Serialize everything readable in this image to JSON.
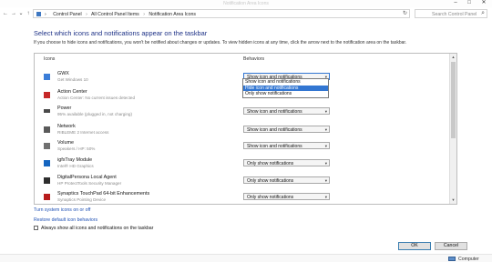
{
  "window": {
    "title": "Notification Area Icons",
    "minimize_glyph": "–",
    "maximize_glyph": "□",
    "close_glyph": "✕"
  },
  "nav": {
    "back_glyph": "←",
    "forward_glyph": "→",
    "recent_glyph": "⌄",
    "up_glyph": "↑"
  },
  "breadcrumb": {
    "items": [
      "Control Panel",
      "All Control Panel Items",
      "Notification Area Icons"
    ],
    "separator": "›",
    "dropdown_glyph": "⌄",
    "refresh_glyph": "↻"
  },
  "search": {
    "placeholder": "Search Control Panel",
    "icon_glyph": "⌕"
  },
  "page": {
    "heading": "Select which icons and notifications appear on the taskbar",
    "description": "If you choose to hide icons and notifications, you won't be notified about changes or updates. To view hidden icons at any time, click the arrow next to the notification area on the taskbar."
  },
  "table": {
    "col_icons": "Icons",
    "col_behaviors": "Behaviors",
    "rows": [
      {
        "name": "GWX",
        "sub": "Get Windows 10",
        "behavior": "Show icon and notifications",
        "icon_color": "#3b7dd8"
      },
      {
        "name": "Action Center",
        "sub": "Action Center: No current issues detected",
        "behavior": "",
        "icon_color": "#c62828"
      },
      {
        "name": "Power",
        "sub": "95% available (plugged in, not charging)",
        "behavior": "Show icon and notifications",
        "icon_color": "#4a4a4a"
      },
      {
        "name": "Network",
        "sub": "RIBLEME 2 Internet access",
        "behavior": "Show icon and notifications",
        "icon_color": "#5a5a5a"
      },
      {
        "name": "Volume",
        "sub": "Speakers / HP: 50%",
        "behavior": "Show icon and notifications",
        "icon_color": "#707070"
      },
      {
        "name": "igfxTray Module",
        "sub": "Intel® HD Graphics",
        "behavior": "Only show notifications",
        "icon_color": "#1565c0"
      },
      {
        "name": "DigitalPersona Local Agent",
        "sub": "HP ProtectTools Security Manager",
        "behavior": "Only show notifications",
        "icon_color": "#2e2e2e"
      },
      {
        "name": "Synaptics TouchPad 64-bit Enhancements",
        "sub": "Synaptics Pointing Device",
        "behavior": "Only show notifications",
        "icon_color": "#b71c1c"
      }
    ],
    "arrow_glyph": "▾",
    "scroll_up_glyph": "▲",
    "scroll_down_glyph": "▼"
  },
  "dropdown": {
    "options": [
      "Show icon and notifications",
      "Hide icon and notifications",
      "Only show notifications"
    ],
    "highlighted_index": 1
  },
  "links": {
    "system_icons": "Turn system icons on or off",
    "restore": "Restore default icon behaviors"
  },
  "always_show": {
    "label": "Always show all icons and notifications on the taskbar",
    "checked": false
  },
  "buttons": {
    "ok": "OK",
    "cancel": "Cancel"
  },
  "status": {
    "text": "Computer"
  }
}
